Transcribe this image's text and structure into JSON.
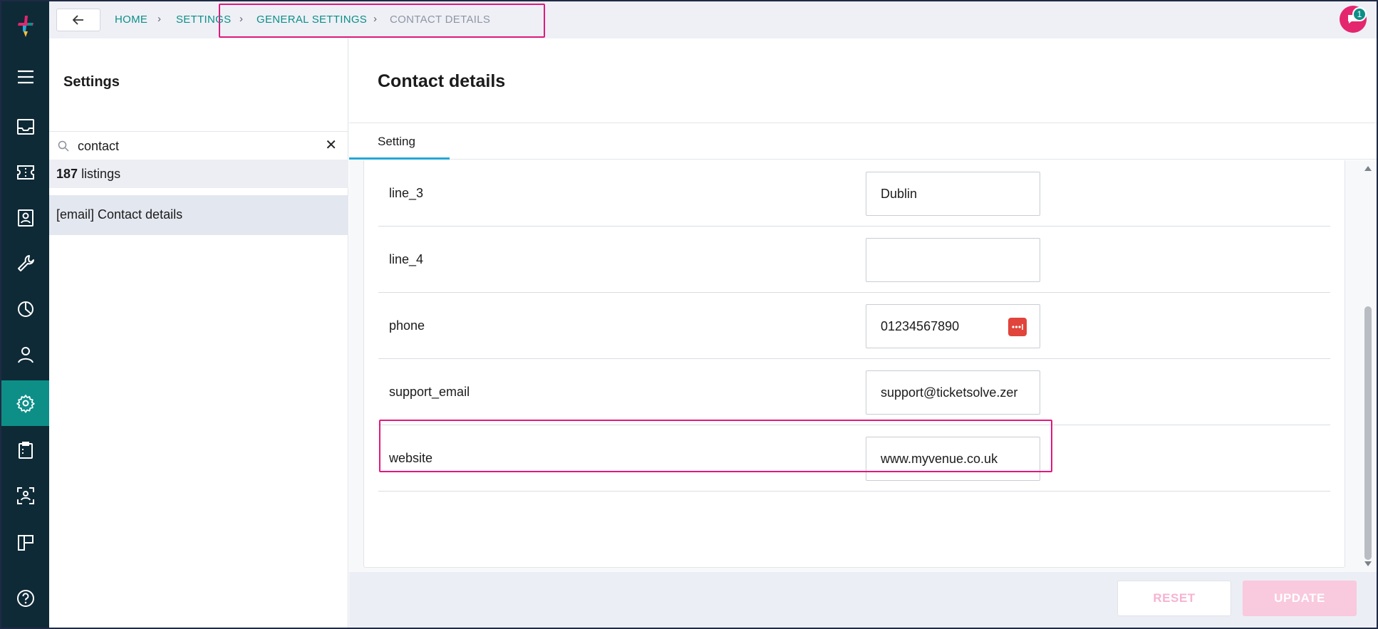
{
  "topbar": {
    "breadcrumb": {
      "home": "HOME",
      "settings": "SETTINGS",
      "general_settings": "GENERAL SETTINGS",
      "contact_details": "CONTACT DETAILS"
    },
    "notification_count": "1"
  },
  "nav": {
    "items": [
      "menu-icon",
      "inbox-icon",
      "ticket-icon",
      "contacts-icon",
      "wrench-icon",
      "reports-icon",
      "user-icon",
      "settings-icon",
      "clipboard-icon",
      "scan-icon",
      "layout-icon",
      "help-icon"
    ],
    "active": "settings-icon"
  },
  "sidebar": {
    "title": "Settings",
    "search": {
      "value": "contact"
    },
    "count_number": "187",
    "count_label": "listings",
    "results": [
      "[email] Contact details"
    ]
  },
  "main": {
    "title": "Contact details",
    "tabs": [
      "Setting"
    ],
    "fields": [
      {
        "label": "line_3",
        "value": "Dublin"
      },
      {
        "label": "line_4",
        "value": ""
      },
      {
        "label": "phone",
        "value": "01234567890"
      },
      {
        "label": "support_email",
        "value": "support@ticketsolve.zer"
      },
      {
        "label": "website",
        "value": "www.myvenue.co.uk"
      }
    ]
  },
  "footer": {
    "reset_label": "RESET",
    "update_label": "UPDATE"
  },
  "colors": {
    "rail": "#0e2a36",
    "accent": "#0d8f88",
    "highlight": "#e0197d",
    "tab_underline": "#25a7d8"
  }
}
